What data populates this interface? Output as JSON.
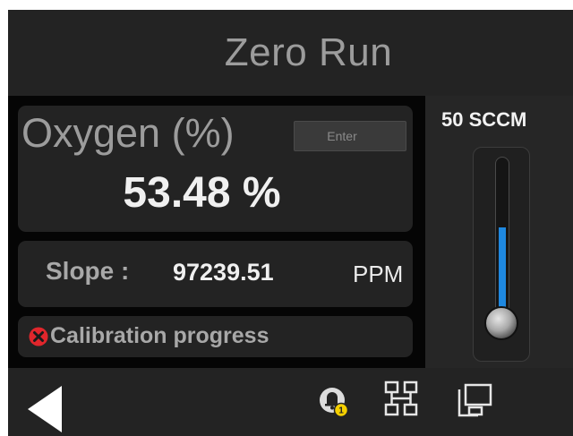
{
  "header": {
    "title": "Zero Run"
  },
  "oxygen": {
    "label": "Oxygen (%)",
    "enter_label": "Enter",
    "value": "53.48 %"
  },
  "slope": {
    "label": "Slope :",
    "value": "97239.51",
    "unit": "PPM"
  },
  "calibration": {
    "status_icon": "error-x-icon",
    "status_color": "#e0262c",
    "label": "Calibration progress"
  },
  "flow": {
    "label": "50 SCCM",
    "level_fraction": 0.6,
    "fill_color": "#1e88e0"
  },
  "footer": {
    "icons": [
      "back-arrow-icon",
      "alarm-bell-icon",
      "network-icon",
      "computer-icon"
    ],
    "alarm_badge": "1",
    "badge_color": "#f5d000"
  }
}
